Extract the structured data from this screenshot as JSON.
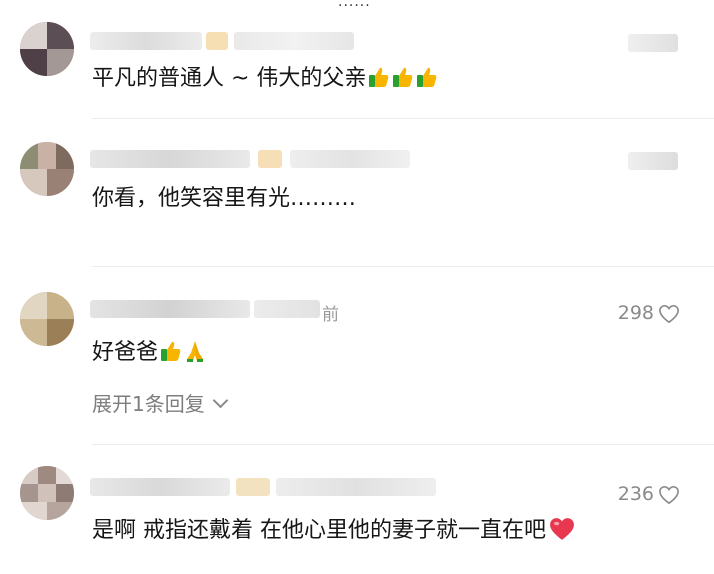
{
  "top_ellipsis": "......",
  "comments": [
    {
      "text": "平凡的普通人 ~ 伟大的父亲",
      "emojis": [
        "thumbs-up",
        "thumbs-up",
        "thumbs-up"
      ]
    },
    {
      "text": "你看，他笑容里有光………",
      "emojis": []
    },
    {
      "meta_suffix": "前",
      "text": "好爸爸",
      "emojis": [
        "thumbs-up",
        "folded-hands"
      ],
      "likes": "298",
      "reply_link": "展开1条回复"
    },
    {
      "text": "是啊 戒指还戴着 在他心里他的妻子就一直在吧",
      "emojis": [
        "red-heart"
      ],
      "likes": "236"
    }
  ],
  "colors": {
    "text": "#161616",
    "muted": "#8a8a8a",
    "divider": "#ececec",
    "thumb_yellow": "#f7b500",
    "cuff_green": "#2aa12f",
    "heart_red": "#e8384f"
  }
}
